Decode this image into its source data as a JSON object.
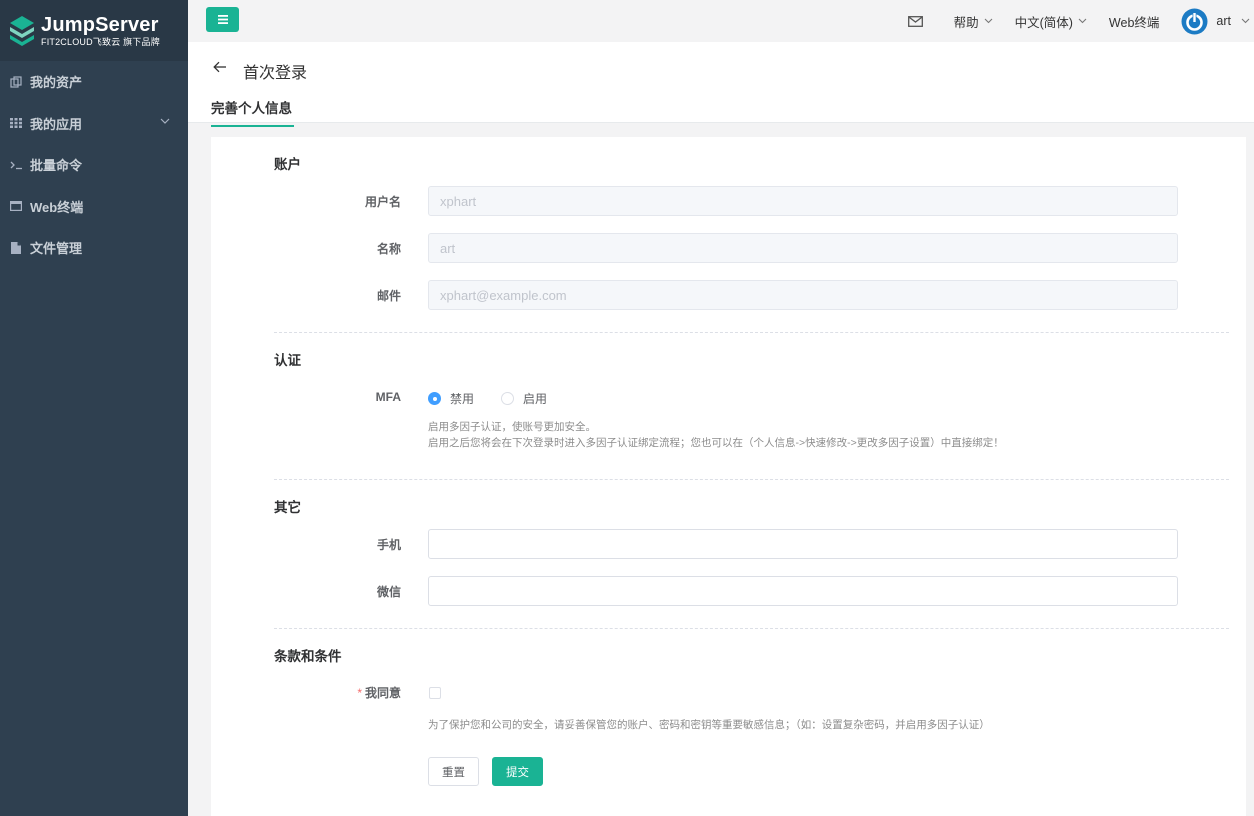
{
  "brand": {
    "title": "JumpServer",
    "subtitle": "FIT2CLOUD飞致云 旗下品牌",
    "accent": "#1ab394",
    "sidebar_bg": "#2f4050"
  },
  "sidebar": {
    "items": [
      {
        "label": "我的资产",
        "icon": "assets-icon"
      },
      {
        "label": "我的应用",
        "icon": "grid-icon",
        "has_children": true
      },
      {
        "label": "批量命令",
        "icon": "terminal-icon"
      },
      {
        "label": "Web终端",
        "icon": "window-icon"
      },
      {
        "label": "文件管理",
        "icon": "file-icon"
      }
    ]
  },
  "header": {
    "mail_icon": "mail-icon",
    "help_label": "帮助",
    "language_label": "中文(简体)",
    "web_terminal_label": "Web终端",
    "user_name": "art"
  },
  "page": {
    "title": "首次登录",
    "tab_label": "完善个人信息"
  },
  "form": {
    "account": {
      "title": "账户",
      "username_label": "用户名",
      "username_value": "xphart",
      "name_label": "名称",
      "name_value": "art",
      "email_label": "邮件",
      "email_value": "xphart@example.com"
    },
    "auth": {
      "title": "认证",
      "mfa_label": "MFA",
      "options": [
        "禁用",
        "启用"
      ],
      "selected": "禁用",
      "help_line1": "启用多因子认证，使账号更加安全。",
      "help_line2": "启用之后您将会在下次登录时进入多因子认证绑定流程；您也可以在（个人信息->快速修改->更改多因子设置）中直接绑定！"
    },
    "other": {
      "title": "其它",
      "phone_label": "手机",
      "phone_value": "",
      "wechat_label": "微信",
      "wechat_value": ""
    },
    "terms": {
      "title": "条款和条件",
      "required_mark": "*",
      "agree_label": "我同意",
      "agree_checked": false,
      "help": "为了保护您和公司的安全，请妥善保管您的账户、密码和密钥等重要敏感信息；（如：设置复杂密码，并启用多因子认证）"
    },
    "buttons": {
      "reset_label": "重置",
      "submit_label": "提交"
    }
  }
}
